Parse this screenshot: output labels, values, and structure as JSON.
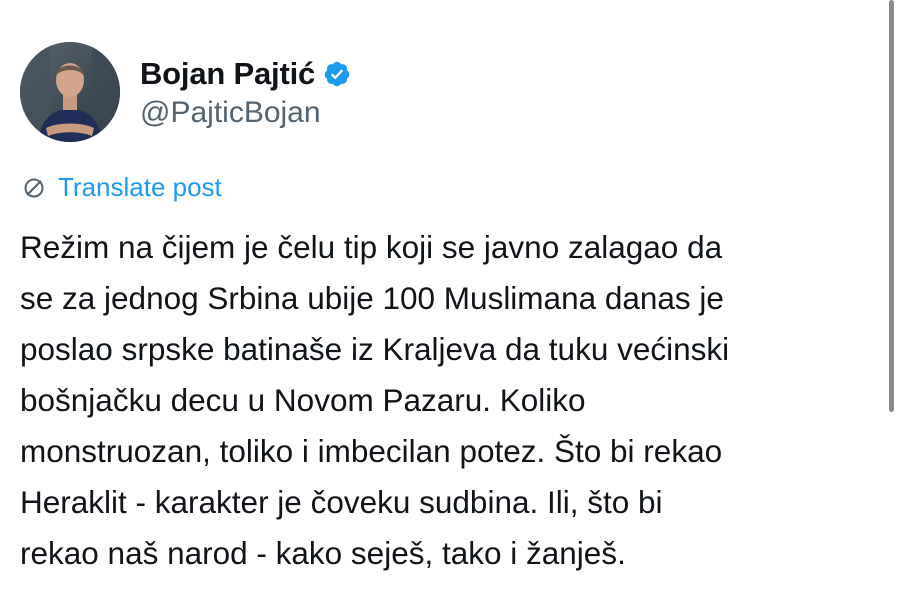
{
  "author": {
    "display_name": "Bojan Pajtić",
    "handle": "@PajticBojan",
    "verified": true,
    "verified_color": "#1d9bf0"
  },
  "translate": {
    "label": "Translate post",
    "icon": "translate-globe-icon",
    "color": "#1d9bf0"
  },
  "post": {
    "text": "Režim na čijem je čelu tip koji se javno zalagao da\nse za jednog Srbina ubije 100 Muslimana danas je\nposlao srpske batinaše iz Kraljeva da tuku većinski\nbošnjačku decu u Novom Pazaru. Koliko\nmonstruozan, toliko i imbecilan potez. Što bi rekao\nHeraklit - karakter je čoveku sudbina. Ili, što bi\nrekao naš narod - kako seješ, tako i žanješ."
  }
}
